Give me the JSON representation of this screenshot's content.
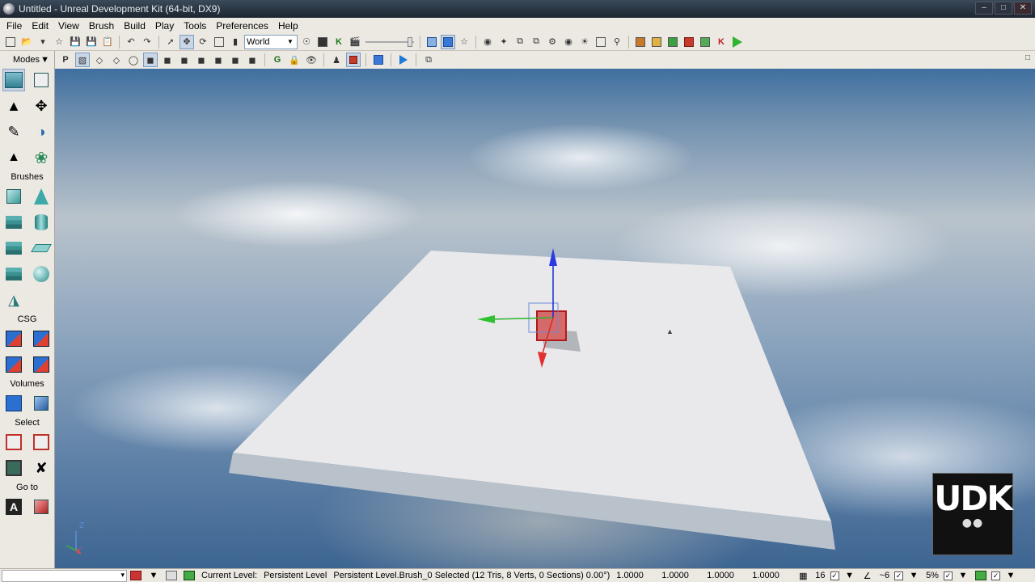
{
  "window": {
    "title": "Untitled - Unreal Development Kit (64-bit, DX9)"
  },
  "menu": [
    "File",
    "Edit",
    "View",
    "Brush",
    "Build",
    "Play",
    "Tools",
    "Preferences",
    "Help"
  ],
  "toolbar": {
    "coordinate_system": "World",
    "view_mode_letter": "P",
    "game_letter": "G",
    "kismet_letter": "K"
  },
  "modes_panel": {
    "header": "Modes",
    "sections": {
      "brushes": "Brushes",
      "csg": "CSG",
      "volumes": "Volumes",
      "select": "Select",
      "goto": "Go to"
    },
    "goto_letter": "A"
  },
  "viewport": {
    "axis_z": "Z",
    "axis_x": "X",
    "logo_text": "UDK"
  },
  "statusbar": {
    "current_level_label": "Current Level:",
    "current_level_value": "Persistent Level",
    "selection_info": "Persistent Level.Brush_0 Selected (12 Tris, 8 Verts, 0 Sections) 0.00°)",
    "scale_fields": [
      "1.0000",
      "1.0000",
      "1.0000",
      "1.0000"
    ],
    "grid_size": "16",
    "rotation_snap": "~6",
    "scale_snap": "5%"
  }
}
